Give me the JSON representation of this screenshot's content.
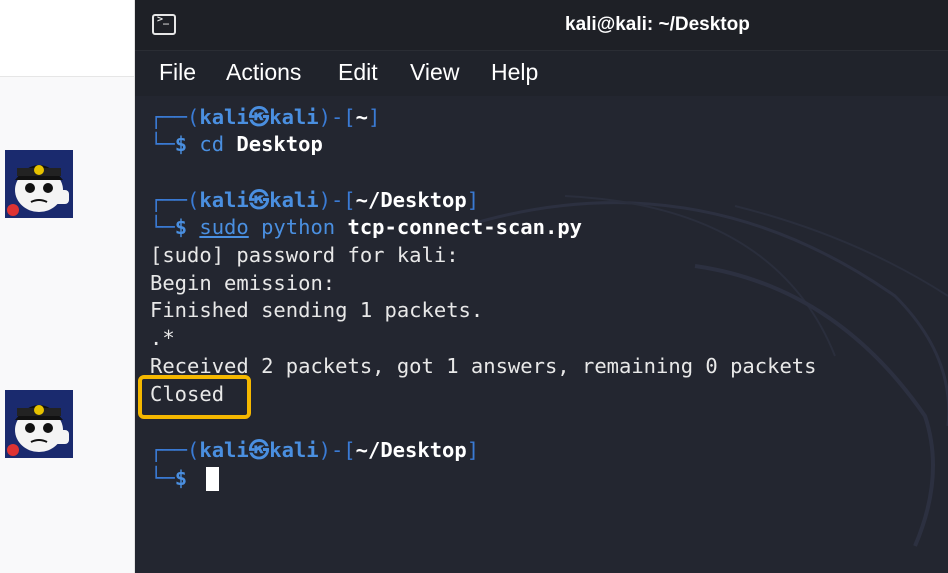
{
  "window": {
    "title": "kali@kali: ~/Desktop",
    "icon": "terminal-icon"
  },
  "menu": [
    {
      "label": "File"
    },
    {
      "label": "Actions"
    },
    {
      "label": "Edit"
    },
    {
      "label": "View"
    },
    {
      "label": "Help"
    }
  ],
  "terminal": {
    "blocks": [
      {
        "prompt": {
          "user": "kali",
          "at": "㉿",
          "host": "kali",
          "path": "~"
        },
        "command": {
          "cmd": "cd",
          "arg": "Desktop"
        }
      },
      {
        "prompt": {
          "user": "kali",
          "at": "㉿",
          "host": "kali",
          "path": "~/Desktop"
        },
        "command": {
          "sudo": "sudo",
          "cmd": "python",
          "arg": "tcp-connect-scan.py"
        },
        "output": [
          "[sudo] password for kali:",
          "Begin emission:",
          "Finished sending 1 packets.",
          ".*",
          "Received 2 packets, got 1 answers, remaining 0 packets",
          "Closed"
        ]
      },
      {
        "prompt": {
          "user": "kali",
          "at": "㉿",
          "host": "kali",
          "path": "~/Desktop"
        }
      }
    ],
    "prompt_symbol": "$",
    "corner_top": "┌──(",
    "corner_bottom": "└─",
    "close_paren": ")-[",
    "close_bracket": "]"
  },
  "colors": {
    "terminal_bg": "#232630",
    "prompt_blue": "#4a8fe0",
    "highlight": "#f5b800"
  },
  "avatars": [
    {
      "name": "avatar-icon"
    },
    {
      "name": "avatar-icon"
    }
  ]
}
